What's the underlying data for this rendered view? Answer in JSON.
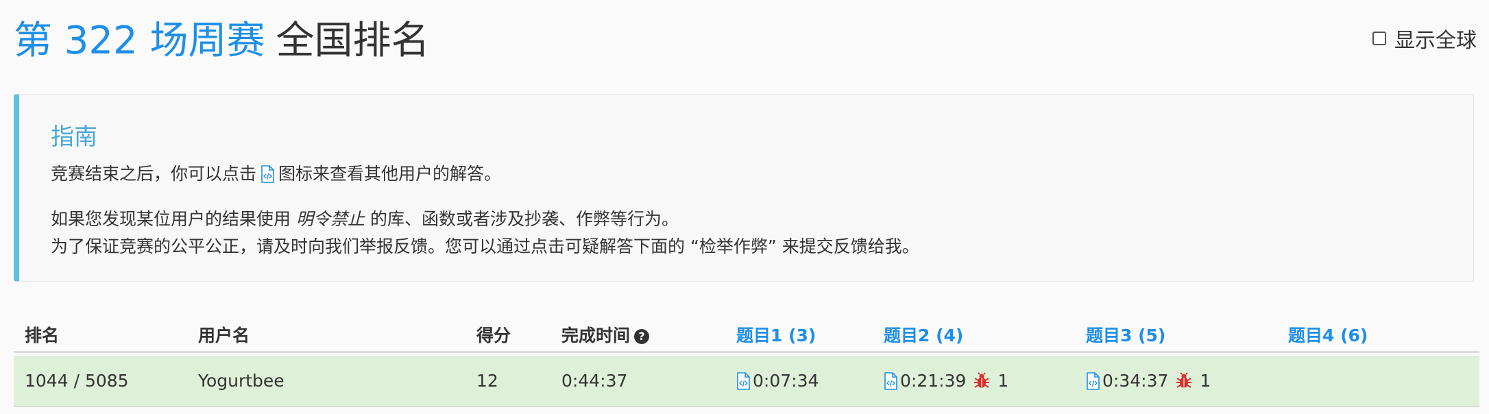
{
  "header": {
    "contest_title": "第 322 场周赛",
    "rank_title": "全国排名",
    "global_label": "显示全球"
  },
  "guide": {
    "title": "指南",
    "line1_before": "竞赛结束之后，你可以点击",
    "line1_after": "图标来查看其他用户的解答。",
    "line2_before": "如果您发现某位用户的结果使用",
    "line2_em": "明令禁止",
    "line2_after": "的库、函数或者涉及抄袭、作弊等行为。",
    "line3": "为了保证竞赛的公平公正，请及时向我们举报反馈。您可以通过点击可疑解答下面的 “检举作弊” 来提交反馈给我。"
  },
  "table": {
    "headers": {
      "rank": "排名",
      "username": "用户名",
      "score": "得分",
      "finish_time": "完成时间",
      "q1": "题目1 (3)",
      "q2": "题目2 (4)",
      "q3": "题目3 (5)",
      "q4": "题目4 (6)"
    },
    "rows": [
      {
        "rank": "1044 / 5085",
        "username": "Yogurtbee",
        "score": "12",
        "finish_time": "0:44:37",
        "q1_time": "0:07:34",
        "q2_time": "0:21:39",
        "q2_bugs": "1",
        "q3_time": "0:34:37",
        "q3_bugs": "1"
      }
    ]
  },
  "icons": {
    "code": "code-file-icon",
    "bug": "bug-icon",
    "help": "question-circle-icon"
  },
  "colors": {
    "accent": "#1e8fe8",
    "guide_border": "#5bc0de",
    "row_bg": "#dff0d8",
    "bug": "#d9302c"
  }
}
